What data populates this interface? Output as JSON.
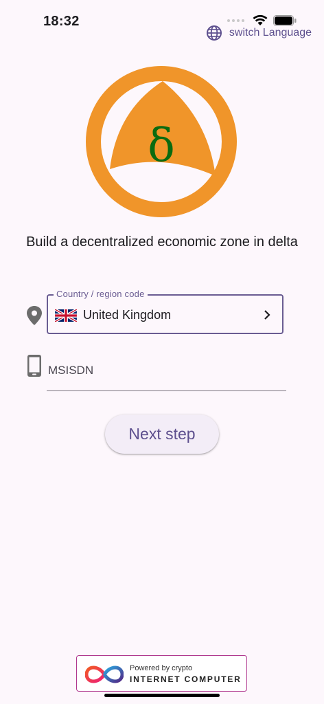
{
  "status_bar": {
    "time": "18:32"
  },
  "header": {
    "switch_language_label": "switch Language"
  },
  "logo": {
    "glyph": "δ",
    "ring_color": "#f0952a",
    "glyph_color": "#0a6b10"
  },
  "tagline": "Build a decentralized economic zone in delta",
  "country_field": {
    "label": "Country / region code",
    "value": "United Kingdom"
  },
  "phone_field": {
    "placeholder": "MSISDN",
    "value": ""
  },
  "next_button": {
    "label": "Next step"
  },
  "footer": {
    "powered_by": "Powered by crypto",
    "brand": "INTERNET COMPUTER"
  },
  "colors": {
    "accent": "#5d4f8e",
    "background": "#fdf7fc",
    "orange": "#f0952a"
  },
  "icons": [
    "wifi-icon",
    "battery-icon",
    "globe-icon",
    "location-pin-icon",
    "uk-flag-icon",
    "chevron-right-icon",
    "phone-icon",
    "infinity-logo-icon"
  ]
}
